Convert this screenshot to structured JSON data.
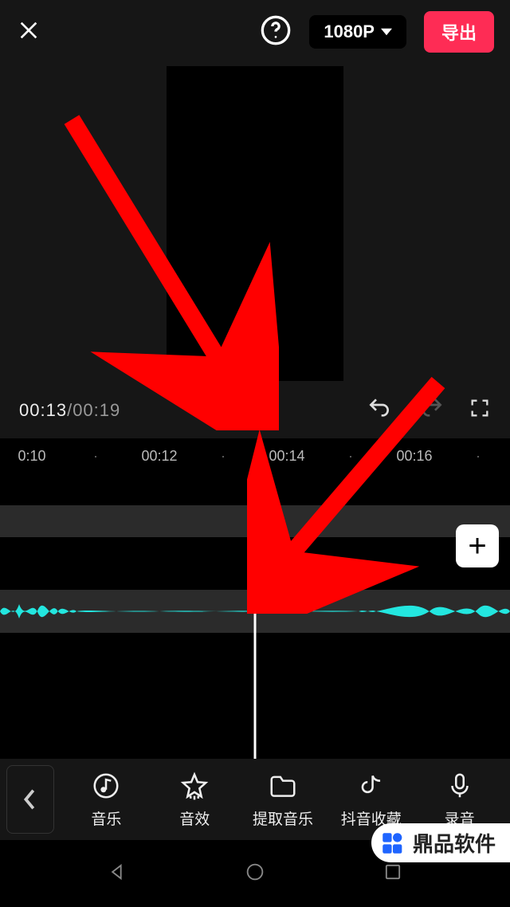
{
  "header": {
    "resolution_label": "1080P",
    "export_label": "导出"
  },
  "transport": {
    "current_time": "00:13",
    "total_time": "00:19"
  },
  "ruler": {
    "ticks": [
      "0:10",
      "·",
      "00:12",
      "·",
      "00:14",
      "·",
      "00:16",
      "·"
    ]
  },
  "add_clip_glyph": "+",
  "tools": {
    "back_chevron": "‹",
    "items": [
      {
        "id": "music",
        "label": "音乐"
      },
      {
        "id": "sfx",
        "label": "音效"
      },
      {
        "id": "extract",
        "label": "提取音乐"
      },
      {
        "id": "douyin",
        "label": "抖音收藏"
      },
      {
        "id": "record",
        "label": "录音"
      }
    ]
  },
  "watermark": {
    "text": "鼎品软件"
  },
  "colors": {
    "accent": "#fe2c55",
    "waveform": "#23e6df",
    "arrow": "#ff0000"
  }
}
